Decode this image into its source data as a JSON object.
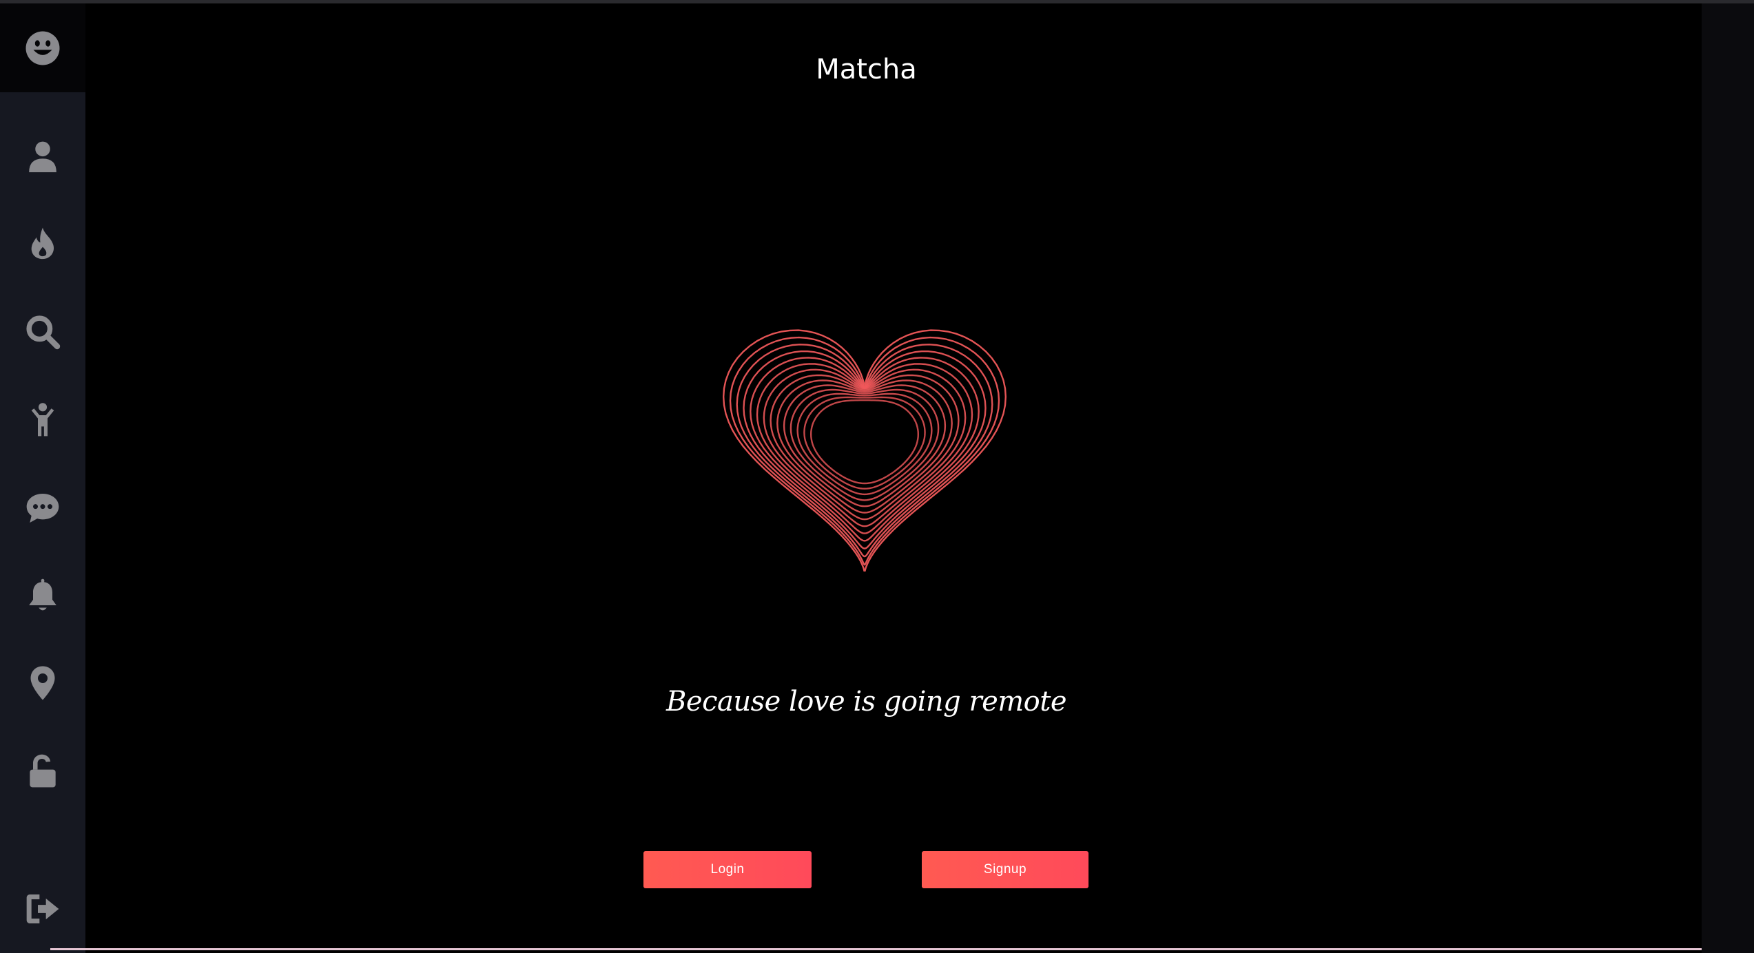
{
  "app": {
    "title": "Matcha",
    "tagline": "Because love is going remote",
    "accent_color": "#ff5a52",
    "heart_color": "#f0585a"
  },
  "sidebar": {
    "logo_icon": "smiley-face-icon",
    "items": [
      {
        "icon": "user-icon"
      },
      {
        "icon": "fire-icon"
      },
      {
        "icon": "search-icon"
      },
      {
        "icon": "child-figure-icon"
      },
      {
        "icon": "chat-bubble-icon"
      },
      {
        "icon": "bell-icon"
      },
      {
        "icon": "map-marker-icon"
      },
      {
        "icon": "unlock-icon"
      }
    ],
    "footer_icon": "sign-out-icon"
  },
  "actions": {
    "login_label": "Login",
    "signup_label": "Signup"
  }
}
